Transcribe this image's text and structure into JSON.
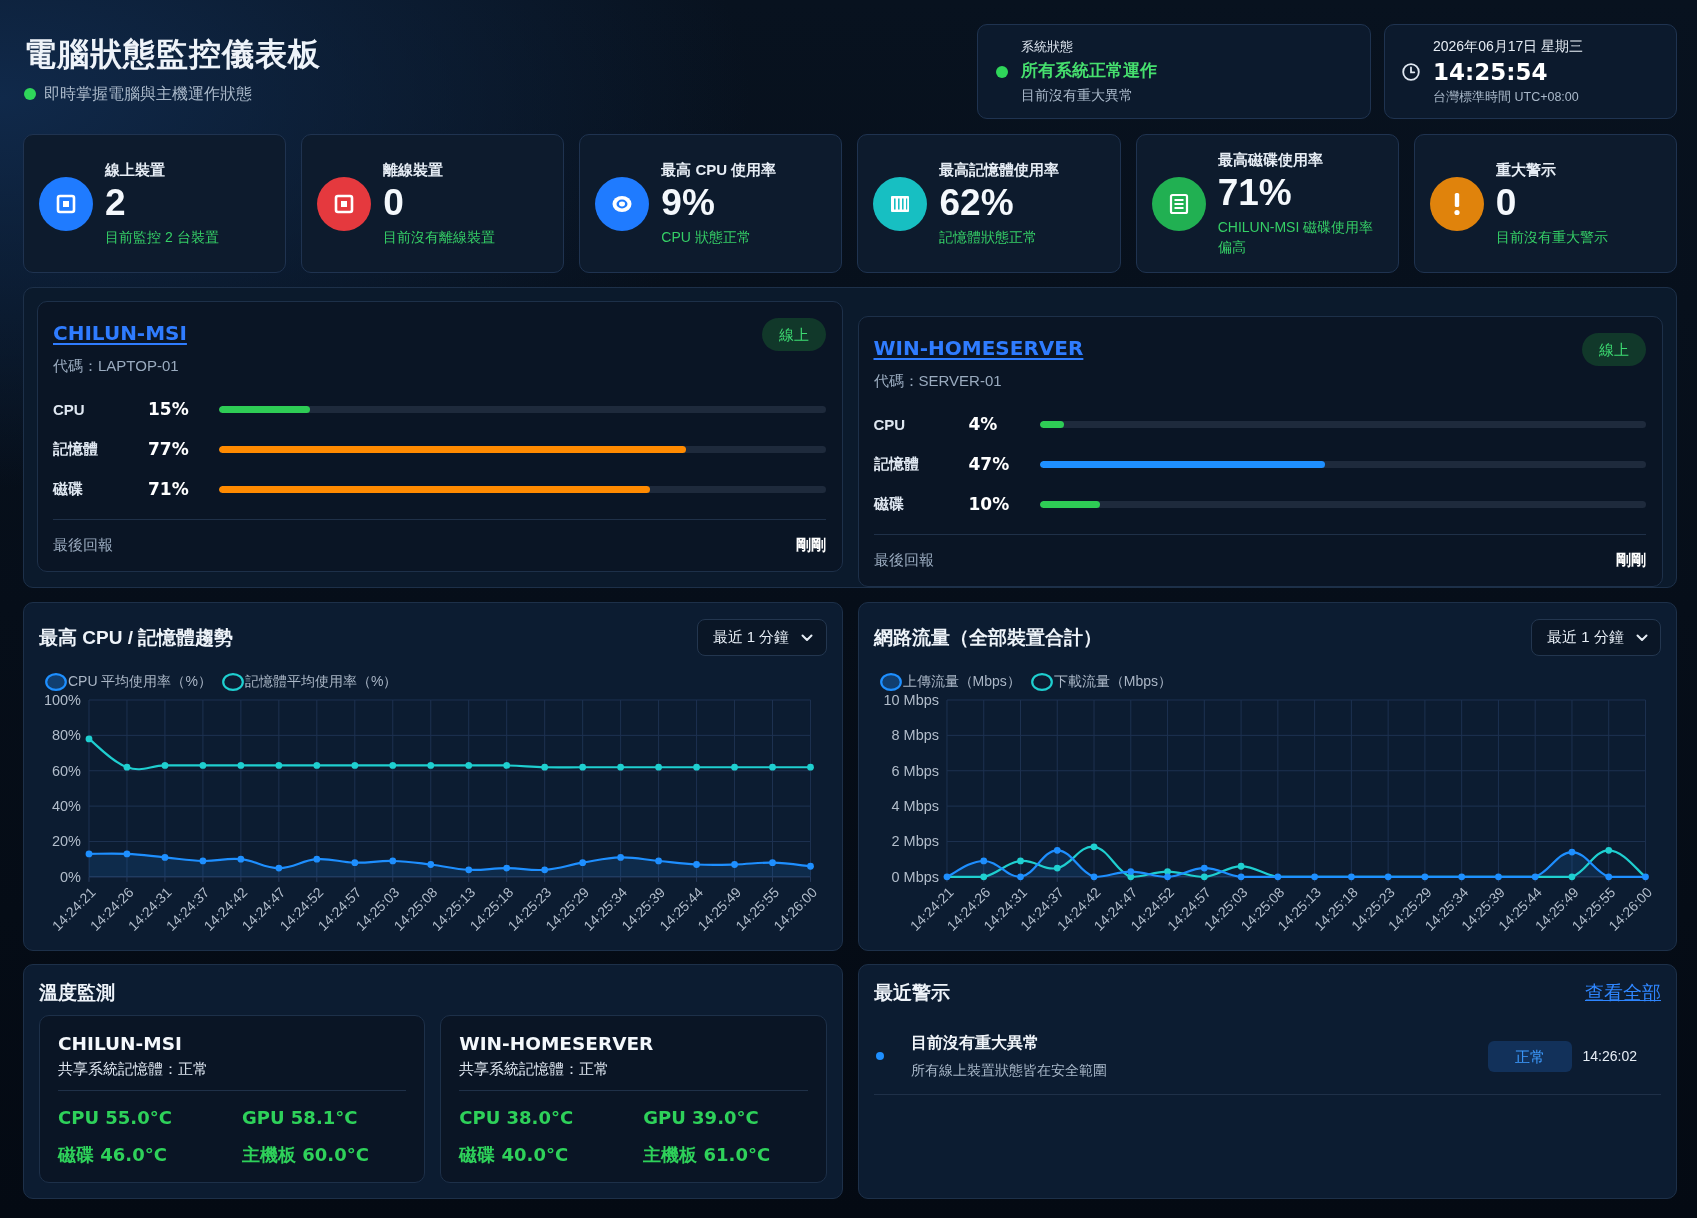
{
  "header": {
    "title": "電腦狀態監控儀表板",
    "subtitle": "即時掌握電腦與主機運作狀態"
  },
  "system_status": {
    "label": "系統狀態",
    "healthy": true,
    "status": "所有系統正常運作",
    "detail": "目前沒有重大異常"
  },
  "clock": {
    "date": "2026年06月17日 星期三",
    "time": "14:25:54",
    "timezone": "台灣標準時間 UTC+08:00"
  },
  "stats": [
    {
      "kind": "device",
      "color": "#1f7bff",
      "title": "線上裝置",
      "value": "2",
      "note": "目前監控 2 台裝置"
    },
    {
      "kind": "device",
      "color": "#e5393e",
      "title": "離線裝置",
      "value": "0",
      "note": "目前沒有離線裝置"
    },
    {
      "kind": "cpu",
      "color": "#1f7bff",
      "title": "最高 CPU 使用率",
      "value": "9%",
      "note": "CPU 狀態正常"
    },
    {
      "kind": "memory",
      "color": "#17bfc2",
      "title": "最高記憶體使用率",
      "value": "62%",
      "note": "記憶體狀態正常"
    },
    {
      "kind": "disk",
      "color": "#21b052",
      "title": "最高磁碟使用率",
      "value": "71%",
      "note": "CHILUN-MSI 磁碟使用率偏高"
    },
    {
      "kind": "alert",
      "color": "#e0830c",
      "title": "重大警示",
      "value": "0",
      "note": "目前沒有重大警示"
    }
  ],
  "devices": [
    {
      "name": "CHILUN-MSI",
      "online": true,
      "status": "線上",
      "code": "代碼：LAPTOP-01",
      "metrics": [
        {
          "label": "CPU",
          "reading": "15%",
          "level": 0.15,
          "color": "#2ecc55"
        },
        {
          "label": "記憶體",
          "reading": "77%",
          "level": 0.77,
          "color": "#ff8a00"
        },
        {
          "label": "磁碟",
          "reading": "71%",
          "level": 0.71,
          "color": "#ff8a00"
        }
      ],
      "last_report_label": "最後回報",
      "last_report": "剛剛"
    },
    {
      "name": "WIN-HOMESERVER",
      "online": true,
      "status": "線上",
      "code": "代碼：SERVER-01",
      "metrics": [
        {
          "label": "CPU",
          "reading": "4%",
          "level": 0.04,
          "color": "#2ecc55"
        },
        {
          "label": "記憶體",
          "reading": "47%",
          "level": 0.47,
          "color": "#1e8fff"
        },
        {
          "label": "磁碟",
          "reading": "10%",
          "level": 0.1,
          "color": "#2ecc55"
        }
      ],
      "last_report_label": "最後回報",
      "last_report": "剛剛"
    }
  ],
  "charts": [
    {
      "title": "最高 CPU / 記憶體趨勢",
      "range": "最近 1 分鐘",
      "chart_data": {
        "type": "line",
        "grid": true,
        "categories": [
          "14:24:21",
          "14:24:26",
          "14:24:31",
          "14:24:37",
          "14:24:42",
          "14:24:47",
          "14:24:52",
          "14:24:57",
          "14:25:03",
          "14:25:08",
          "14:25:13",
          "14:25:18",
          "14:25:23",
          "14:25:29",
          "14:25:34",
          "14:25:39",
          "14:25:44",
          "14:25:49",
          "14:25:55",
          "14:26:00"
        ],
        "series": [
          {
            "name": "CPU 平均使用率（%）",
            "color": "#1e8fff",
            "marker": "circle",
            "values": [
              13,
              13,
              11,
              9,
              10,
              5,
              10,
              8,
              9,
              7,
              4,
              5,
              4,
              8,
              11,
              9,
              7,
              7,
              8,
              6
            ]
          },
          {
            "name": "記憶體平均使用率（%）",
            "color": "#1fcfd0",
            "marker": "circle",
            "values": [
              78,
              62,
              63,
              63,
              63,
              63,
              63,
              63,
              63,
              63,
              63,
              63,
              62,
              62,
              62,
              62,
              62,
              62,
              62,
              62
            ]
          }
        ],
        "ylim": [
          0,
          100
        ],
        "yticks": [
          {
            "value": 0,
            "label": "0%"
          },
          {
            "value": 20,
            "label": "20%"
          },
          {
            "value": 40,
            "label": "40%"
          },
          {
            "value": 60,
            "label": "60%"
          },
          {
            "value": 80,
            "label": "80%"
          },
          {
            "value": 100,
            "label": "100%"
          }
        ]
      }
    },
    {
      "title": "網路流量（全部裝置合計）",
      "range": "最近 1 分鐘",
      "chart_data": {
        "type": "line",
        "grid": true,
        "categories": [
          "14:24:21",
          "14:24:26",
          "14:24:31",
          "14:24:37",
          "14:24:42",
          "14:24:47",
          "14:24:52",
          "14:24:57",
          "14:25:03",
          "14:25:08",
          "14:25:13",
          "14:25:18",
          "14:25:23",
          "14:25:29",
          "14:25:34",
          "14:25:39",
          "14:25:44",
          "14:25:49",
          "14:25:55",
          "14:26:00"
        ],
        "series": [
          {
            "name": "上傳流量（Mbps）",
            "color": "#1e8fff",
            "marker": "circle",
            "values": [
              0,
              0.9,
              0,
              1.5,
              0,
              0.3,
              0,
              0.5,
              0,
              0,
              0,
              0,
              0,
              0,
              0,
              0,
              0,
              1.4,
              0,
              0
            ]
          },
          {
            "name": "下載流量（Mbps）",
            "color": "#1fcfd0",
            "marker": "circle",
            "values": [
              0,
              0,
              0.9,
              0.5,
              1.7,
              0,
              0.3,
              0,
              0.6,
              0,
              0,
              0,
              0,
              0,
              0,
              0,
              0,
              0,
              1.5,
              0
            ]
          }
        ],
        "ylim": [
          0,
          10
        ],
        "yticks": [
          {
            "value": 0,
            "label": "0 Mbps"
          },
          {
            "value": 2,
            "label": "2 Mbps"
          },
          {
            "value": 4,
            "label": "4 Mbps"
          },
          {
            "value": 6,
            "label": "6 Mbps"
          },
          {
            "value": 8,
            "label": "8 Mbps"
          },
          {
            "value": 10,
            "label": "10 Mbps"
          }
        ]
      }
    }
  ],
  "temperature": {
    "title": "溫度監測",
    "devices": [
      {
        "name": "CHILUN-MSI",
        "memory": "共享系統記憶體：正常",
        "readings": [
          "CPU 55.0°C",
          "GPU 58.1°C",
          "磁碟 46.0°C",
          "主機板 60.0°C"
        ]
      },
      {
        "name": "WIN-HOMESERVER",
        "memory": "共享系統記憶體：正常",
        "readings": [
          "CPU 38.0°C",
          "GPU 39.0°C",
          "磁碟 40.0°C",
          "主機板 61.0°C"
        ]
      }
    ]
  },
  "alerts": {
    "title": "最近警示",
    "view_all": "查看全部",
    "items": [
      {
        "color": "#1e8fff",
        "title": "目前沒有重大異常",
        "detail": "所有線上裝置狀態皆在安全範圍",
        "status": "正常",
        "time": "14:26:02"
      }
    ]
  }
}
